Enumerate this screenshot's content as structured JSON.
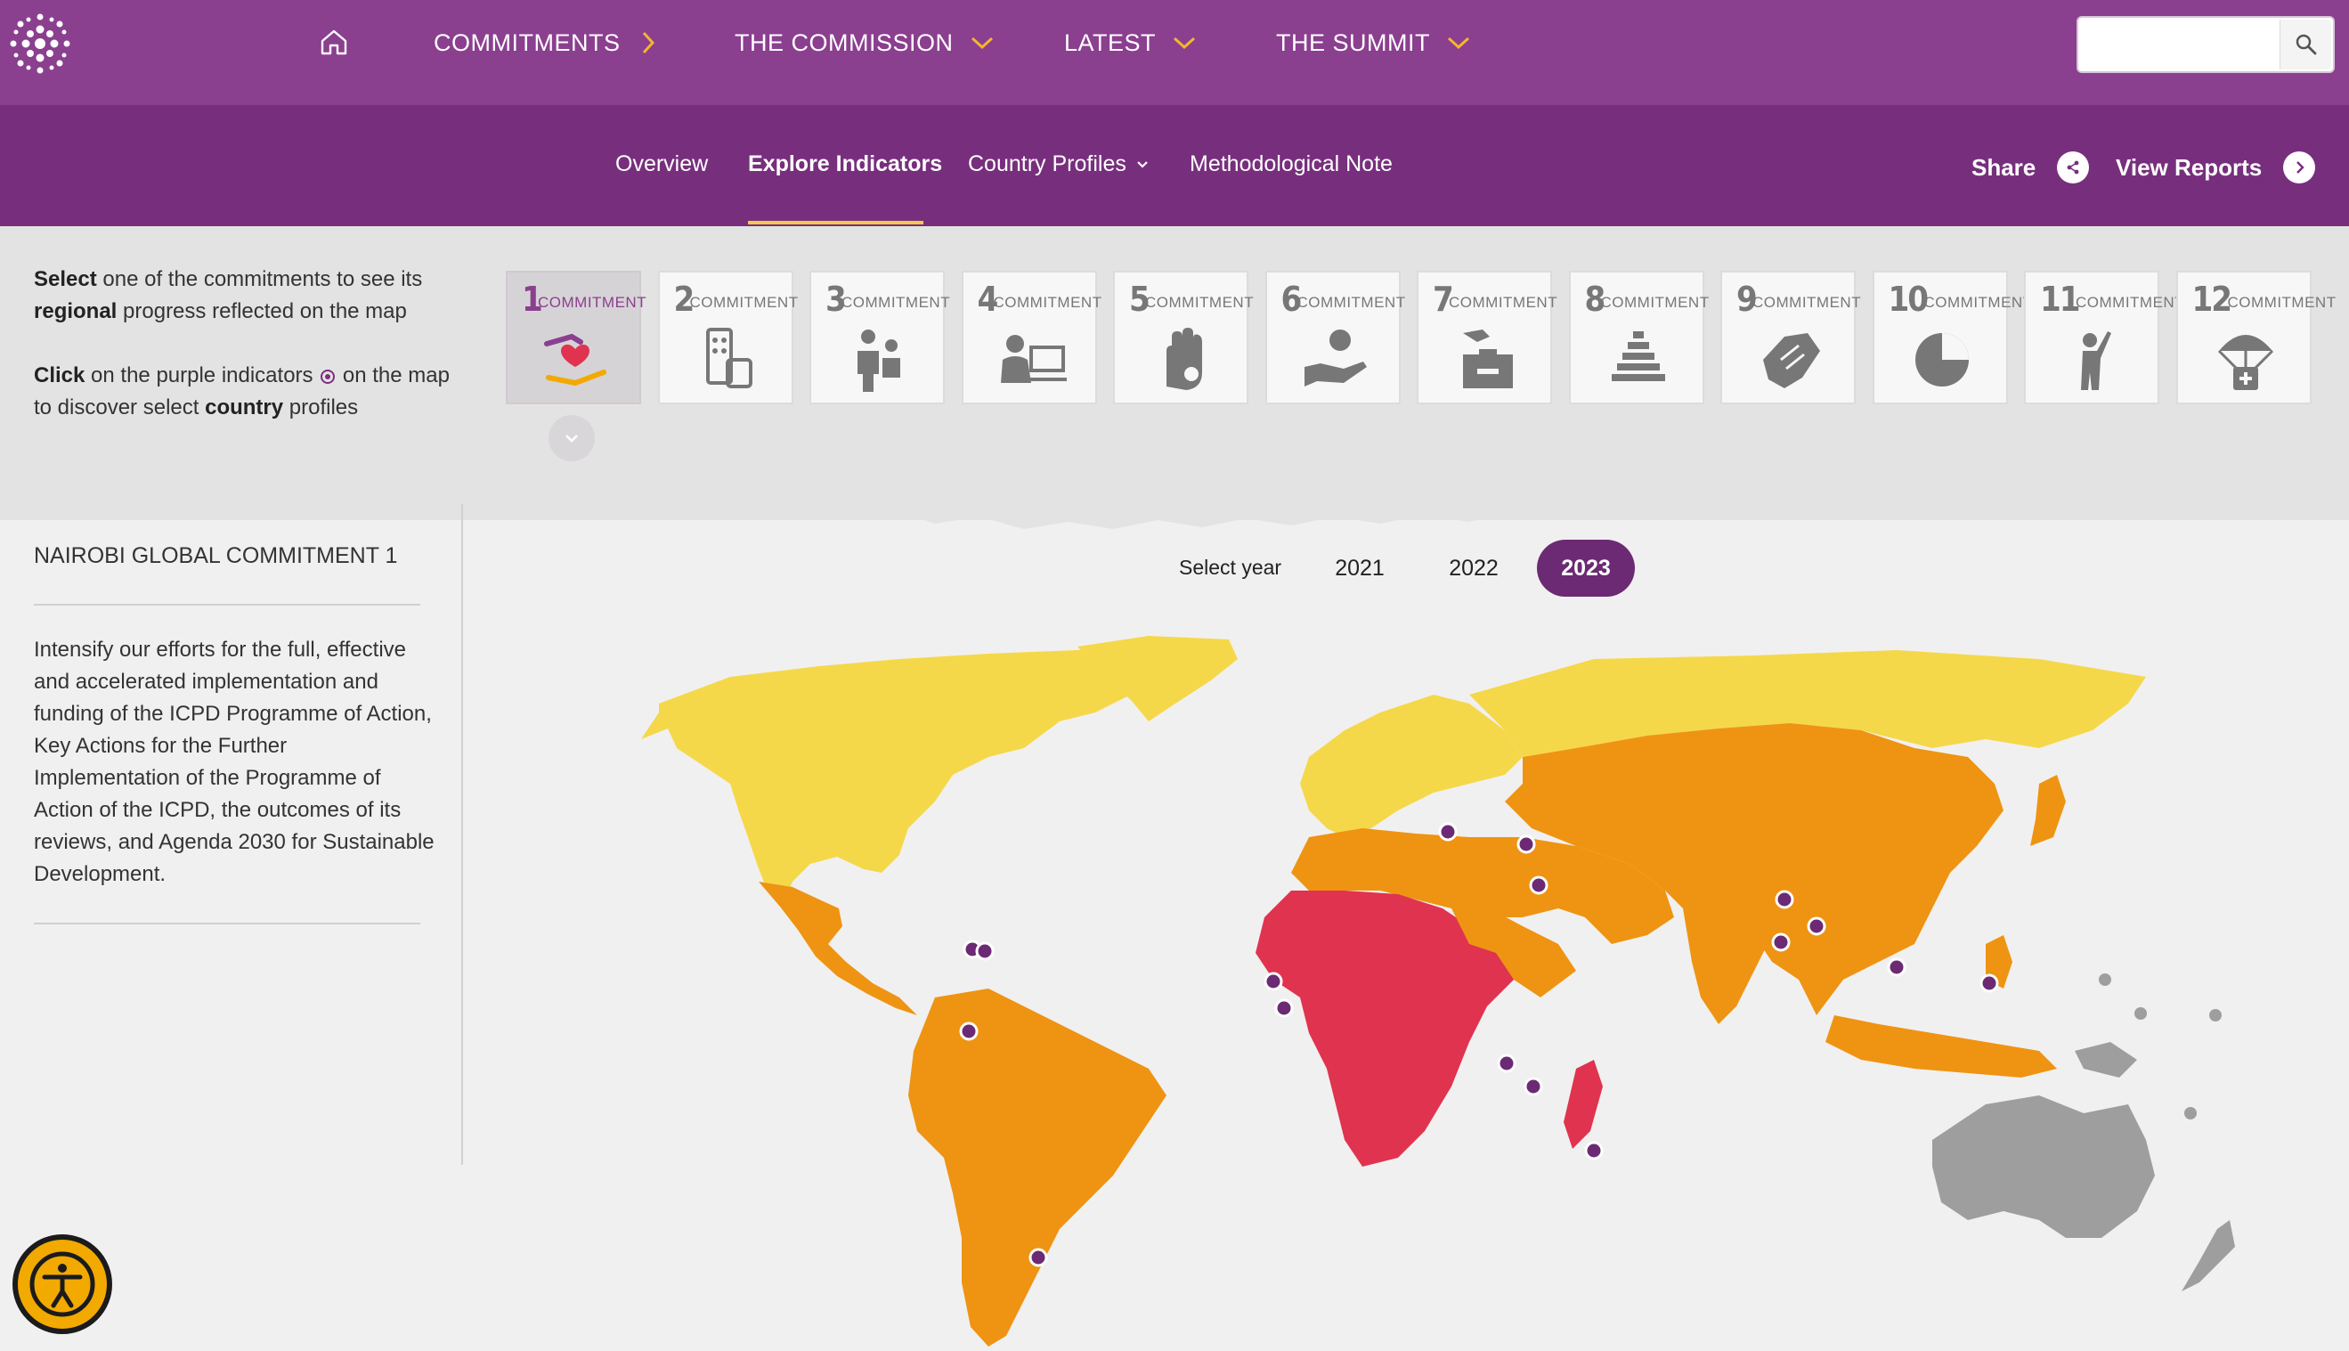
{
  "nav": {
    "items": [
      {
        "label": "COMMITMENTS"
      },
      {
        "label": "THE COMMISSION"
      },
      {
        "label": "LATEST"
      },
      {
        "label": "THE SUMMIT"
      }
    ],
    "search_placeholder": ""
  },
  "subnav": {
    "items": [
      "Overview",
      "Explore Indicators",
      "Country Profiles",
      "Methodological Note"
    ],
    "active": "Explore Indicators",
    "share_label": "Share",
    "reports_label": "View Reports"
  },
  "intro": {
    "select_bold": "Select",
    "select_rest": " one of the commitments to see its",
    "regional_bold": "regional",
    "regional_rest": " progress reflected on the map",
    "click_bold": "Click",
    "click_rest1": " on the purple indicators",
    "click_rest2": " on the map",
    "discover_text": "to discover select ",
    "country_bold": "country",
    "profiles_text": " profiles"
  },
  "commitment_word": "COMMITMENT",
  "commitments": [
    {
      "number": "1",
      "icon": "hands-heart-icon",
      "selected": true
    },
    {
      "number": "2",
      "icon": "contraceptive-pills-icon"
    },
    {
      "number": "3",
      "icon": "mother-child-icon"
    },
    {
      "number": "4",
      "icon": "student-computer-icon"
    },
    {
      "number": "5",
      "icon": "raised-hand-female-icon"
    },
    {
      "number": "6",
      "icon": "hand-coin-icon"
    },
    {
      "number": "7",
      "icon": "hand-ballot-box-icon"
    },
    {
      "number": "8",
      "icon": "population-pyramid-icon"
    },
    {
      "number": "9",
      "icon": "handshake-icon"
    },
    {
      "number": "10",
      "icon": "pie-chart-icon"
    },
    {
      "number": "11",
      "icon": "youth-raised-arm-icon"
    },
    {
      "number": "12",
      "icon": "aid-parachute-icon"
    }
  ],
  "panel": {
    "title": "NAIROBI GLOBAL COMMITMENT 1",
    "text": "Intensify our efforts for the full, effective and accelerated implementation and funding of the ICPD Programme of Action, Key Actions for the Further Implementation of the Programme of Action of the ICPD, the outcomes of its reviews, and Agenda 2030 for Sustainable Development."
  },
  "year_select": {
    "label": "Select year",
    "options": [
      "2021",
      "2022",
      "2023"
    ],
    "selected": "2023"
  },
  "map_colors": {
    "high": "#f5d84a",
    "medium": "#ee9412",
    "low": "#e0334f",
    "no_data": "#9e9e9e",
    "indicator": "#6b2a73"
  }
}
